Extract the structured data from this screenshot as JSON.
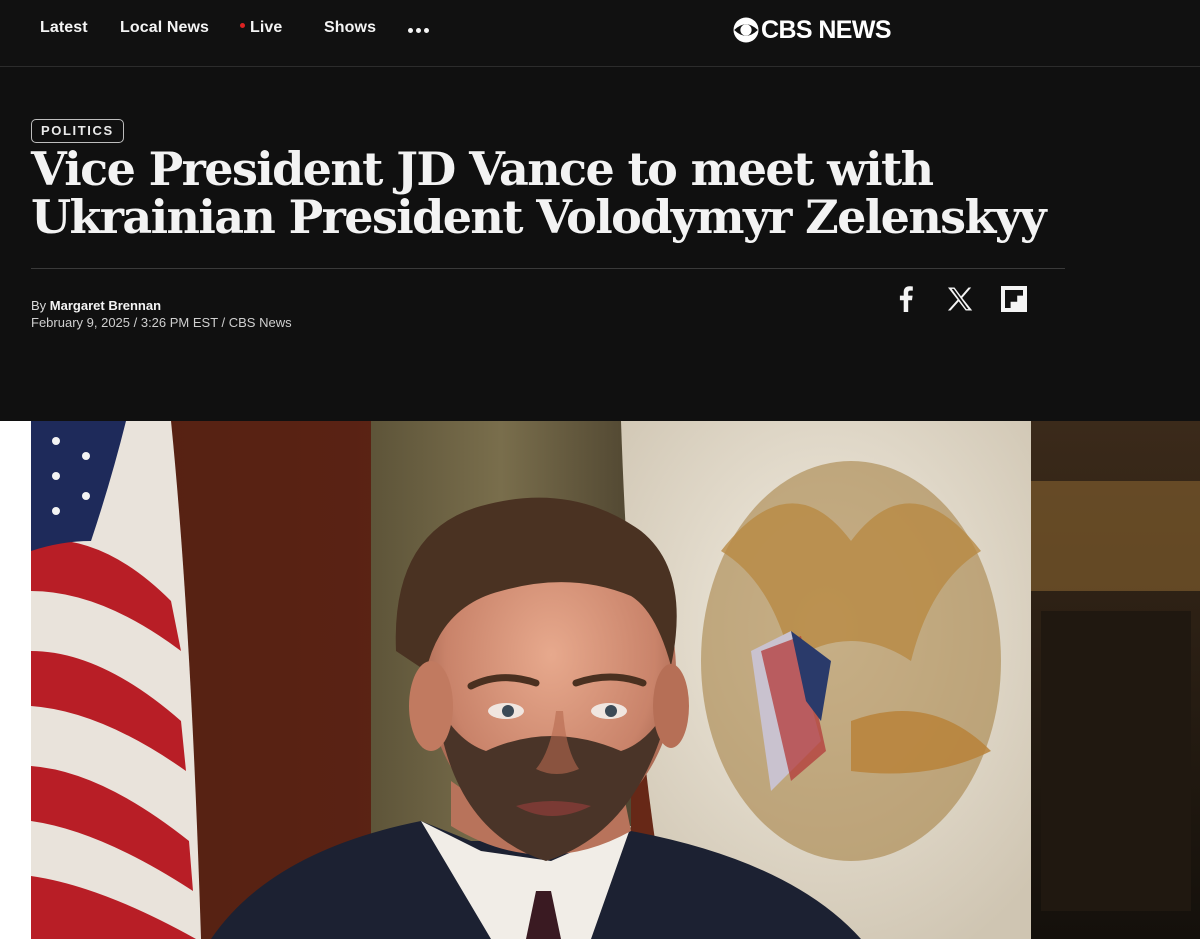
{
  "nav": {
    "items": [
      {
        "label": "Latest"
      },
      {
        "label": "Local News"
      },
      {
        "label": "Live"
      },
      {
        "label": "Shows"
      }
    ],
    "more_icon": "ellipsis-icon",
    "live_dot_color": "#dd2222"
  },
  "brand": {
    "logo_text": "CBS NEWS",
    "logo_icon": "cbs-eye-icon"
  },
  "article": {
    "section": "POLITICS",
    "headline": "Vice President JD Vance to meet with Ukrainian President Volodymyr Zelenskyy",
    "byline_prefix": "By",
    "author": "Margaret Brennan",
    "dateline": "February 9, 2025 / 3:26 PM EST / CBS News"
  },
  "share": {
    "icons": [
      "facebook-icon",
      "x-icon",
      "flipboard-icon"
    ]
  },
  "colors": {
    "background": "#101010",
    "text": "#ffffff"
  }
}
